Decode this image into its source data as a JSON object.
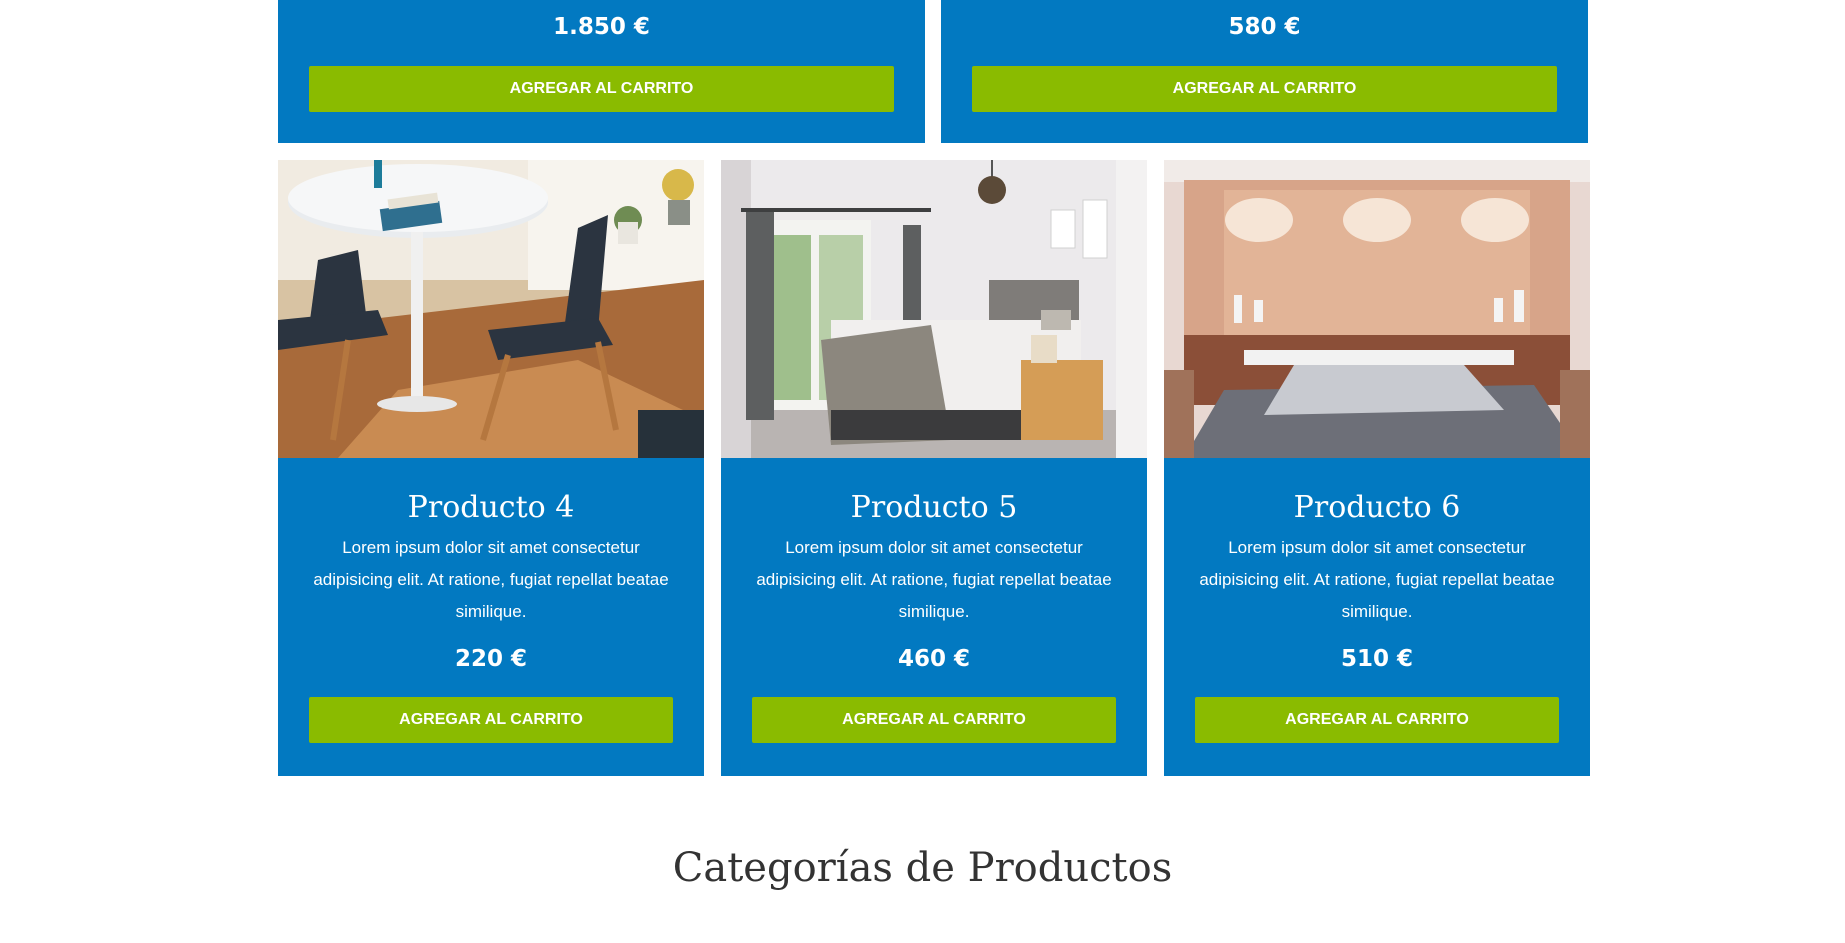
{
  "top_products": [
    {
      "price": "1.850 €",
      "button": "AGREGAR AL CARRITO"
    },
    {
      "price": "580 €",
      "button": "AGREGAR AL CARRITO"
    }
  ],
  "products": [
    {
      "name": "Producto 4",
      "description": "Lorem ipsum dolor sit amet consectetur adipisicing elit. At ratione, fugiat repellat beatae similique.",
      "price": "220 €",
      "button": "AGREGAR AL CARRITO",
      "image": "dining-room-photo"
    },
    {
      "name": "Producto 5",
      "description": "Lorem ipsum dolor sit amet consectetur adipisicing elit. At ratione, fugiat repellat beatae similique.",
      "price": "460 €",
      "button": "AGREGAR AL CARRITO",
      "image": "bedroom-photo"
    },
    {
      "name": "Producto 6",
      "description": "Lorem ipsum dolor sit amet consectetur adipisicing elit. At ratione, fugiat repellat beatae similique.",
      "price": "510 €",
      "button": "AGREGAR AL CARRITO",
      "image": "bedroom-photo"
    }
  ],
  "categories_title": "Categorías de Productos",
  "colors": {
    "card": "#0279c1",
    "button": "#8abb00"
  }
}
